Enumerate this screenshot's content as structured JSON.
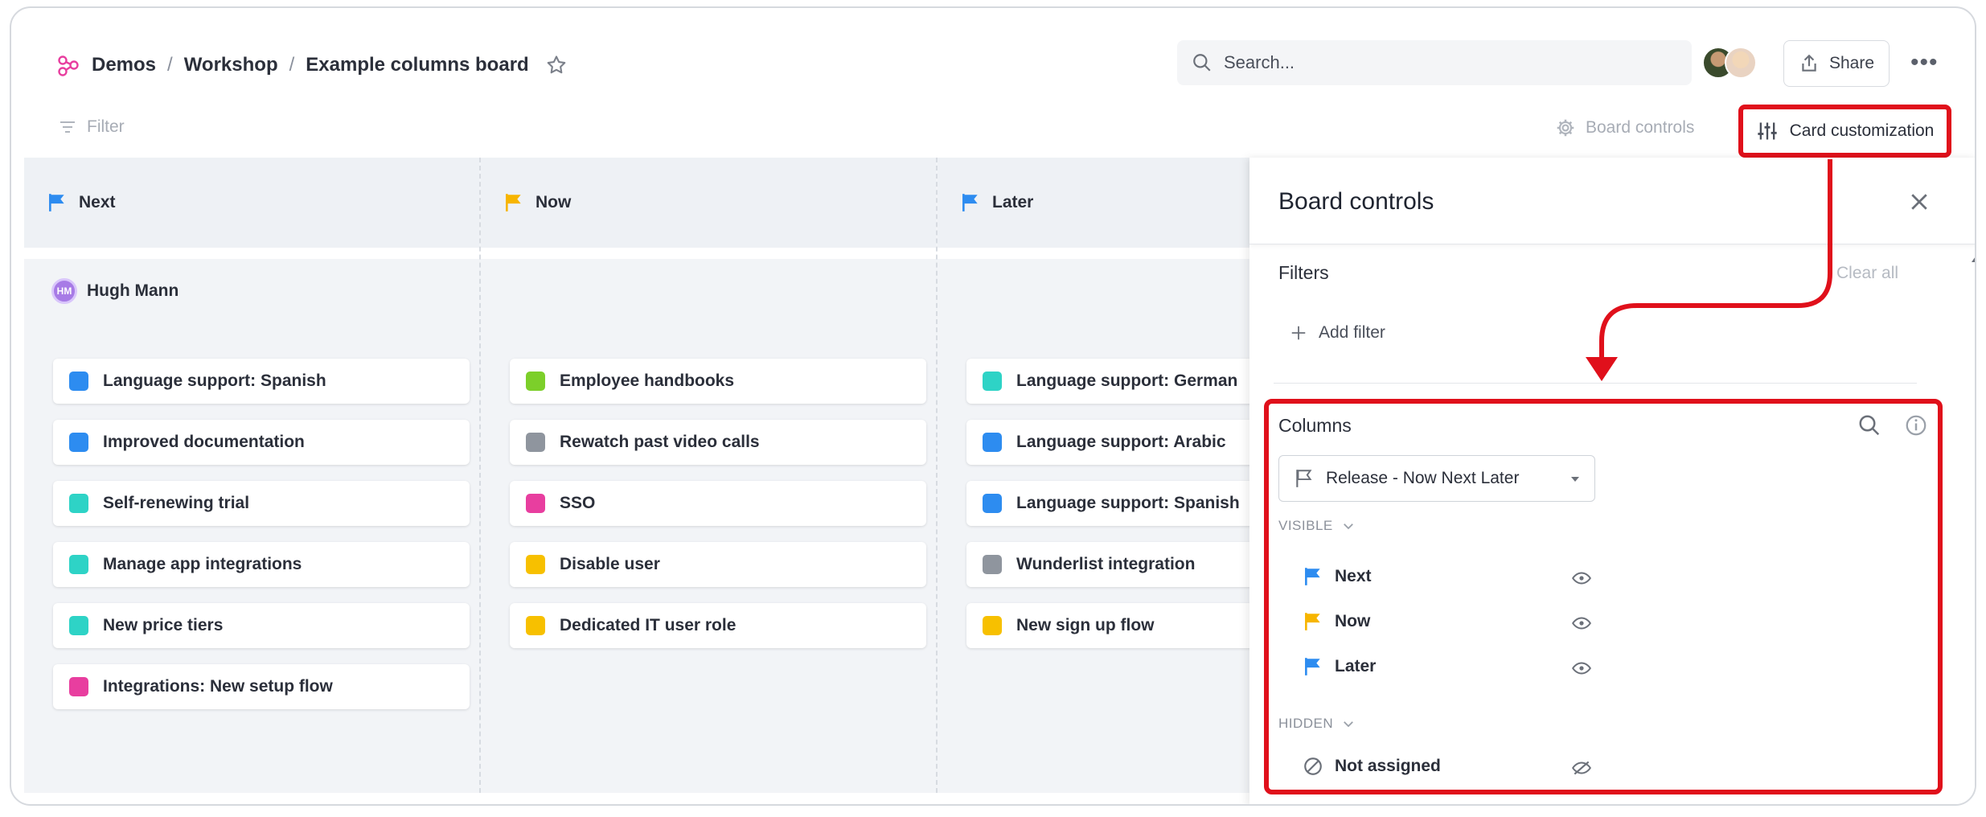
{
  "breadcrumb": {
    "root": "Demos",
    "sep1": "/",
    "middle": "Workshop",
    "sep2": "/",
    "current": "Example columns board"
  },
  "search": {
    "placeholder": "Search..."
  },
  "header": {
    "share_label": "Share",
    "more_label": "•••"
  },
  "toolbar": {
    "filter_label": "Filter",
    "board_controls_label": "Board controls",
    "card_customization_label": "Card customization"
  },
  "columns": [
    {
      "label": "Next",
      "flag_color": "#2d8cf0"
    },
    {
      "label": "Now",
      "flag_color": "#f7b500"
    },
    {
      "label": "Later",
      "flag_color": "#2d8cf0"
    }
  ],
  "lane": {
    "owner_initials": "HM",
    "owner_name": "Hugh Mann"
  },
  "cards": {
    "next": [
      {
        "label": "Language support: Spanish",
        "color": "#2d8cf0"
      },
      {
        "label": "Improved documentation",
        "color": "#2d8cf0"
      },
      {
        "label": "Self-renewing trial",
        "color": "#2ed3c6"
      },
      {
        "label": "Manage app integrations",
        "color": "#2ed3c6"
      },
      {
        "label": "New price tiers",
        "color": "#2ed3c6"
      },
      {
        "label": "Integrations: New setup flow",
        "color": "#e83e9f"
      }
    ],
    "now": [
      {
        "label": "Employee handbooks",
        "color": "#7ccf2a"
      },
      {
        "label": "Rewatch past video calls",
        "color": "#8f959e"
      },
      {
        "label": "SSO",
        "color": "#e83e9f"
      },
      {
        "label": "Disable user",
        "color": "#f7c000"
      },
      {
        "label": "Dedicated IT user role",
        "color": "#f7c000"
      }
    ],
    "later": [
      {
        "label": "Language support: German",
        "color": "#2ed3c6"
      },
      {
        "label": "Language support: Arabic",
        "color": "#2d8cf0"
      },
      {
        "label": "Language support: Spanish",
        "color": "#2d8cf0"
      },
      {
        "label": "Wunderlist integration",
        "color": "#8f959e"
      },
      {
        "label": "New sign up flow",
        "color": "#f7c000"
      }
    ]
  },
  "panel": {
    "title": "Board controls",
    "filters_label": "Filters",
    "clear_all_label": "Clear all",
    "add_filter_label": "Add filter",
    "columns_label": "Columns",
    "column_source": "Release - Now Next Later",
    "visible_label": "VISIBLE",
    "hidden_label": "HIDDEN",
    "visible_items": [
      {
        "label": "Next",
        "flag_color": "#2d8cf0"
      },
      {
        "label": "Now",
        "flag_color": "#f7b500"
      },
      {
        "label": "Later",
        "flag_color": "#2d8cf0"
      }
    ],
    "hidden_items": [
      {
        "label": "Not assigned"
      }
    ]
  },
  "colors": {
    "highlight": "#e0101b",
    "brand": "#e83e9f"
  }
}
